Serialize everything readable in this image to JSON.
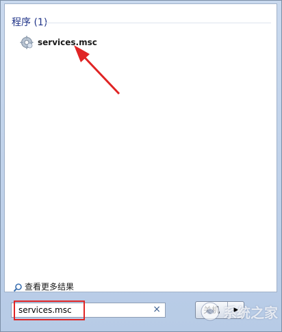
{
  "results": {
    "section_title": "程序 (1)",
    "items": [
      {
        "label": "services.msc",
        "icon": "gear-icon"
      }
    ]
  },
  "see_more": {
    "label": "查看更多结果",
    "icon": "magnifier-icon"
  },
  "search": {
    "value": "services.msc",
    "clear_icon": "×"
  },
  "power": {
    "button_label": "关机",
    "arrow_icon": "▶"
  },
  "annotation": {
    "color": "#e02424"
  },
  "watermark": {
    "text": "系统之家"
  }
}
